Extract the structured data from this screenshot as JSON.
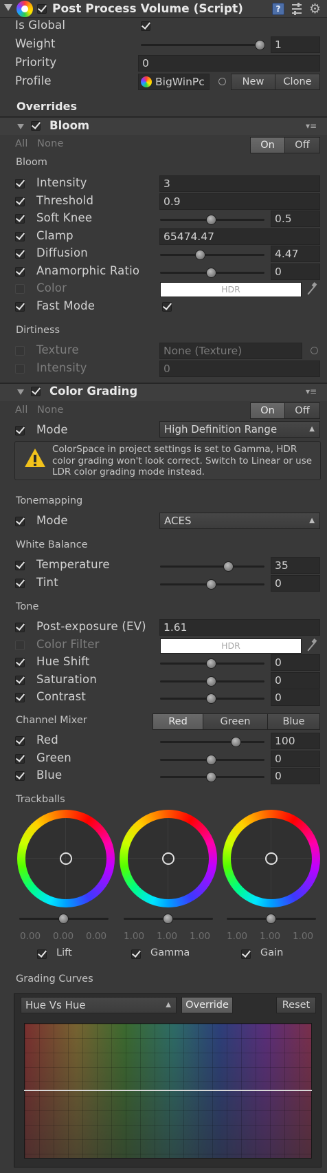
{
  "component": {
    "title": "Post Process Volume (Script)",
    "header_icons": [
      "book-help-icon",
      "preset-icon",
      "gear-icon"
    ]
  },
  "main": {
    "is_global_label": "Is Global",
    "weight_label": "Weight",
    "weight_value": "1",
    "weight_fraction": 1,
    "priority_label": "Priority",
    "priority_value": "0",
    "profile_label": "Profile",
    "profile_value": "BigWinPc",
    "new_label": "New",
    "clone_label": "Clone",
    "overrides_label": "Overrides"
  },
  "bloom": {
    "title": "Bloom",
    "all_label": "All",
    "none_label": "None",
    "on_label": "On",
    "off_label": "Off",
    "section_bloom": "Bloom",
    "intensity_label": "Intensity",
    "intensity_value": "3",
    "threshold_label": "Threshold",
    "threshold_value": "0.9",
    "soft_knee_label": "Soft Knee",
    "soft_knee_value": "0.5",
    "clamp_label": "Clamp",
    "clamp_value": "65474.47",
    "diffusion_label": "Diffusion",
    "diffusion_value": "4.47",
    "anamorphic_label": "Anamorphic Ratio",
    "anamorphic_value": "0",
    "color_label": "Color",
    "color_hdr": "HDR",
    "fast_mode_label": "Fast Mode",
    "section_dirtiness": "Dirtiness",
    "texture_label": "Texture",
    "texture_value": "None (Texture)",
    "dirt_intensity_label": "Intensity",
    "dirt_intensity_value": "0"
  },
  "color_grading": {
    "title": "Color Grading",
    "all_label": "All",
    "none_label": "None",
    "on_label": "On",
    "off_label": "Off",
    "mode_label": "Mode",
    "mode_value": "High Definition Range",
    "warning_text": "ColorSpace in project settings is set to Gamma, HDR color grading won't look correct. Switch to Linear or use LDR color grading mode instead.",
    "section_tonemapping": "Tonemapping",
    "tonemap_mode_label": "Mode",
    "tonemap_mode_value": "ACES",
    "section_white_balance": "White Balance",
    "temperature_label": "Temperature",
    "temperature_value": "35",
    "tint_label": "Tint",
    "tint_value": "0",
    "section_tone": "Tone",
    "post_exposure_label": "Post-exposure (EV)",
    "post_exposure_value": "1.61",
    "color_filter_label": "Color Filter",
    "color_filter_hdr": "HDR",
    "hue_shift_label": "Hue Shift",
    "hue_shift_value": "0",
    "saturation_label": "Saturation",
    "saturation_value": "0",
    "contrast_label": "Contrast",
    "contrast_value": "0",
    "section_channel_mixer": "Channel Mixer",
    "mixer_tabs": [
      "Red",
      "Green",
      "Blue"
    ],
    "mixer_red_label": "Red",
    "mixer_red_value": "100",
    "mixer_green_label": "Green",
    "mixer_green_value": "0",
    "mixer_blue_label": "Blue",
    "mixer_blue_value": "0",
    "section_trackballs": "Trackballs",
    "trackballs": [
      {
        "label": "Lift",
        "values": [
          "0.00",
          "0.00",
          "0.00"
        ]
      },
      {
        "label": "Gamma",
        "values": [
          "1.00",
          "1.00",
          "1.00"
        ]
      },
      {
        "label": "Gain",
        "values": [
          "1.00",
          "1.00",
          "1.00"
        ]
      }
    ],
    "section_grading_curves": "Grading Curves",
    "curve_select_value": "Hue Vs Hue",
    "override_label": "Override",
    "reset_label": "Reset"
  },
  "colors": {
    "background": "#393939",
    "field": "#2b2b2b",
    "header": "#3e3e3e"
  }
}
